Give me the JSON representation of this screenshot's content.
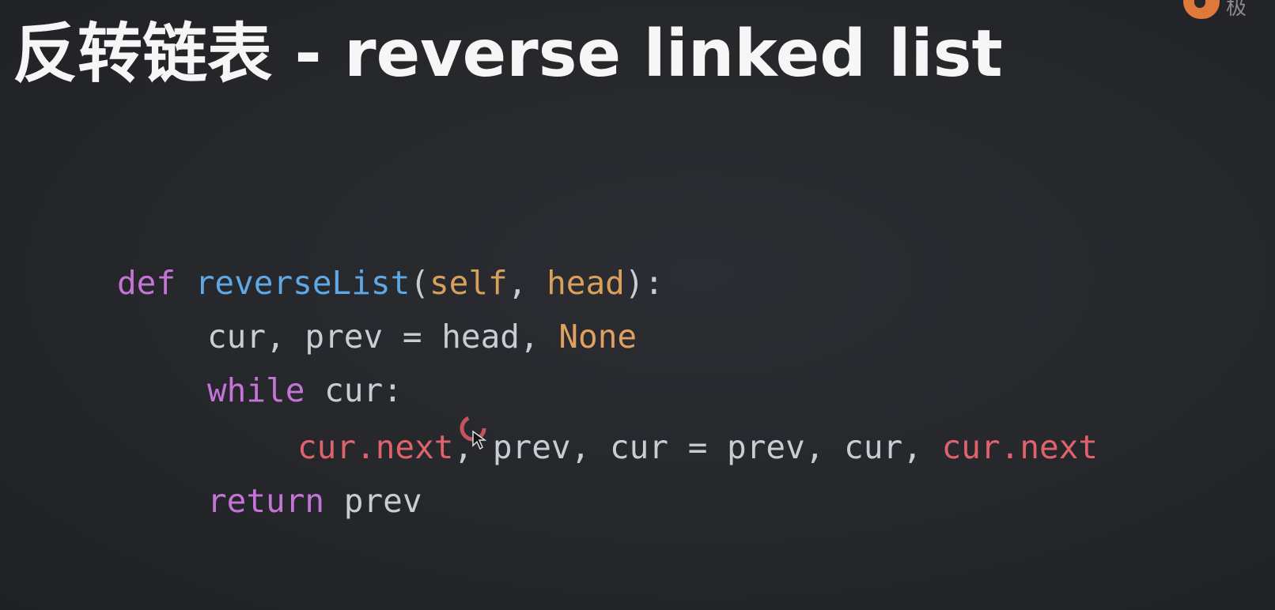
{
  "slide": {
    "title": "反转链表 - reverse linked list",
    "logo_text": "极"
  },
  "code": {
    "line1": {
      "kw_def": "def",
      "fn_name": "reverseList",
      "open_paren": "(",
      "param_self": "self",
      "comma": ", ",
      "param_head": "head",
      "close": "):"
    },
    "line2": {
      "lhs": "cur, prev = head, ",
      "none": "None"
    },
    "line3": {
      "kw_while": "while",
      "rest": " cur:"
    },
    "line4": {
      "lhs_attr": "cur.next",
      "middle": ", prev, cur = prev, cur, ",
      "rhs_attr": "cur.next"
    },
    "line5": {
      "kw_return": "return",
      "rest": " prev"
    }
  },
  "colors": {
    "background": "#25272b",
    "keyword": "#c474d6",
    "function": "#5fa8e6",
    "parameter": "#d9a05b",
    "constant": "#e0a060",
    "attribute": "#e0626d",
    "plain": "#c9cdd3",
    "logo": "#e0783a"
  },
  "icons": {
    "cursor": "loading-cursor-icon",
    "logo": "logo-icon"
  }
}
